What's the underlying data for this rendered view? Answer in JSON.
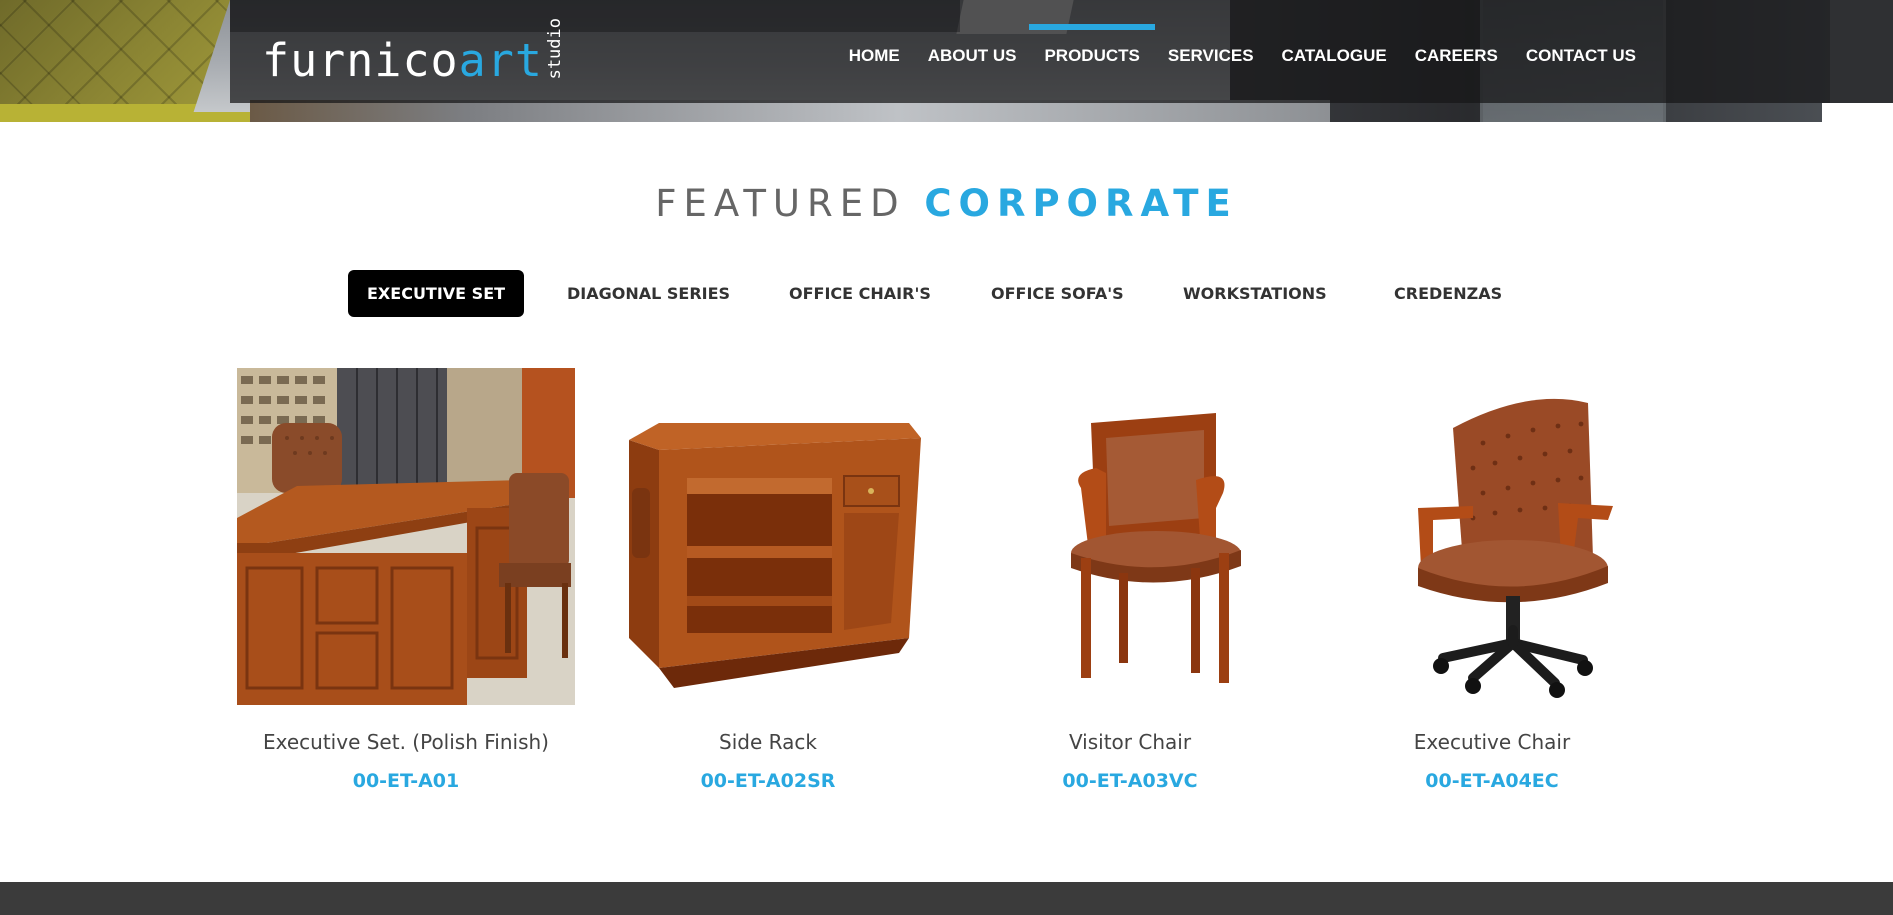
{
  "brand": {
    "name_main": "furnico",
    "name_accent": "art",
    "name_sub": "studio"
  },
  "nav": [
    {
      "label": "HOME",
      "active": false
    },
    {
      "label": "ABOUT US",
      "active": false
    },
    {
      "label": "PRODUCTS",
      "active": true
    },
    {
      "label": "SERVICES",
      "active": false
    },
    {
      "label": "CATALOGUE",
      "active": false
    },
    {
      "label": "CAREERS",
      "active": false
    },
    {
      "label": "CONTACT US",
      "active": false
    }
  ],
  "heading": {
    "part1": "FEATURED",
    "part2": "CORPORATE"
  },
  "tabs": [
    {
      "label": "EXECUTIVE SET",
      "active": true
    },
    {
      "label": "DIAGONAL SERIES",
      "active": false
    },
    {
      "label": "OFFICE CHAIR'S",
      "active": false
    },
    {
      "label": "OFFICE SOFA'S",
      "active": false
    },
    {
      "label": "WORKSTATIONS",
      "active": false
    },
    {
      "label": "CREDENZAS",
      "active": false
    }
  ],
  "products": [
    {
      "name": "Executive Set. (Polish Finish)",
      "code": "00-ET-A01",
      "image": "executive-desk-photo"
    },
    {
      "name": "Side Rack",
      "code": "00-ET-A02SR",
      "image": "side-rack-photo"
    },
    {
      "name": "Visitor Chair",
      "code": "00-ET-A03VC",
      "image": "visitor-chair-photo"
    },
    {
      "name": "Executive Chair",
      "code": "00-ET-A04EC",
      "image": "executive-chair-photo"
    }
  ],
  "colors": {
    "accent": "#29a8e0",
    "tab_active_bg": "#000000",
    "heading_grey": "#666666",
    "footer": "#3b3b3b"
  }
}
